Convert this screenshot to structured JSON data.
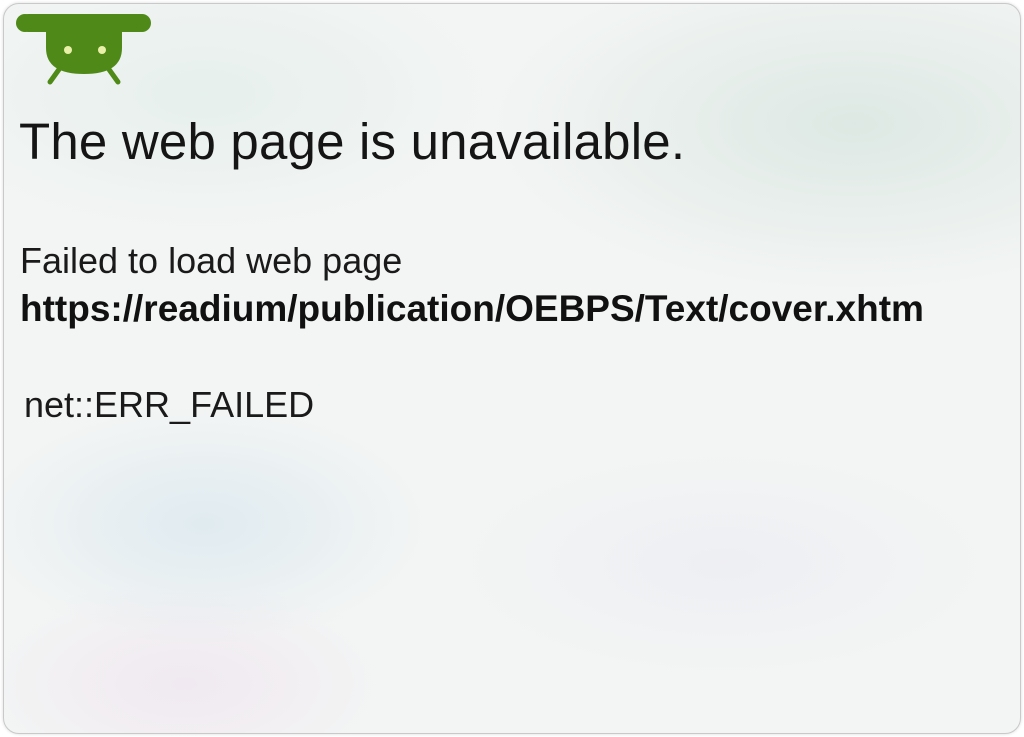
{
  "error_page": {
    "title": "The web page is unavailable.",
    "description": "Failed to load web page",
    "url": "https://readium/publication/OEBPS/Text/cover.xhtm",
    "error_code": "net::ERR_FAILED"
  },
  "icon": {
    "name": "android-robot-icon",
    "color": "#4f8a18"
  }
}
